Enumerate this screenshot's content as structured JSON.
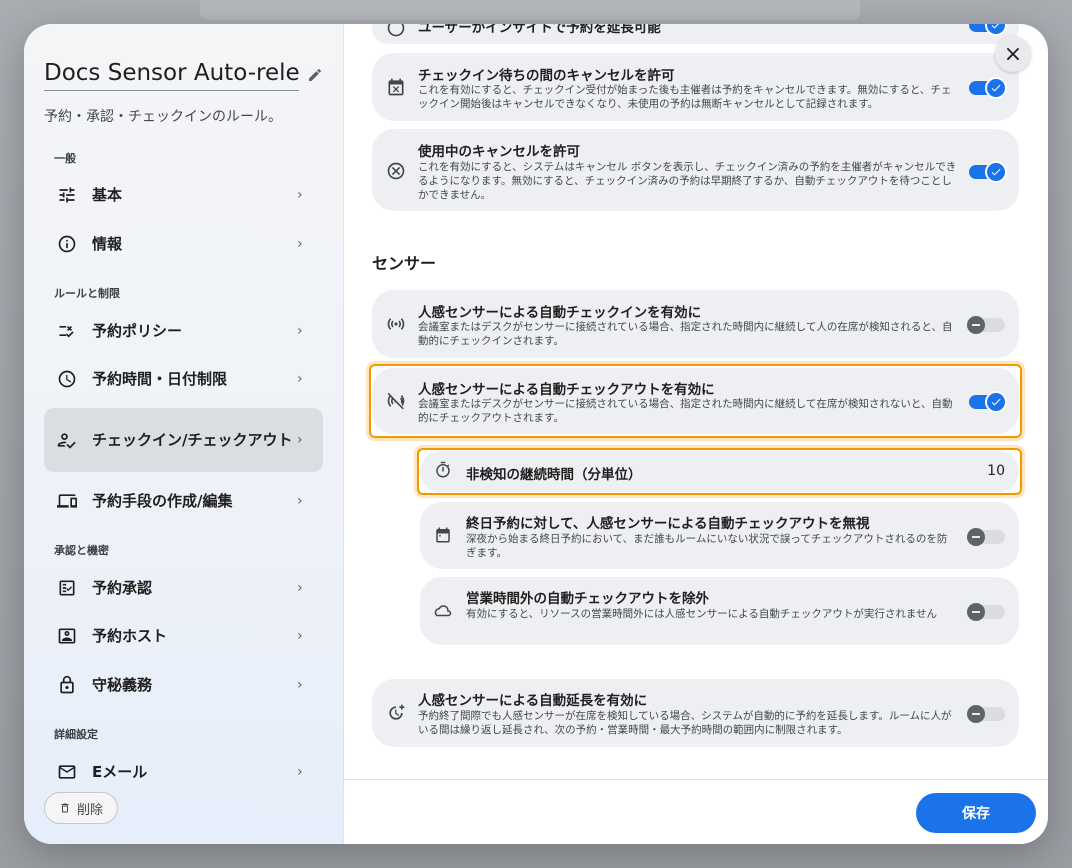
{
  "dialog": {
    "title": "Docs Sensor Auto-release",
    "subtitle": "予約・承認・チェックインのルール。",
    "close_label": "×",
    "delete_label": "削除",
    "save_label": "保存"
  },
  "sidebar": {
    "sections": [
      {
        "label": "一般"
      },
      {
        "label": "ルールと制限"
      },
      {
        "label": "承認と機密"
      },
      {
        "label": "詳細設定"
      }
    ],
    "items": [
      {
        "label": "基本",
        "icon": "tune-icon"
      },
      {
        "label": "情報",
        "icon": "info-icon"
      },
      {
        "label": "予約ポリシー",
        "icon": "rule-icon"
      },
      {
        "label": "予約時間・日付制限",
        "icon": "clock-icon"
      },
      {
        "label": "チェックイン/チェックアウト",
        "icon": "person-check-icon",
        "active": true
      },
      {
        "label": "予約手段の作成/編集",
        "icon": "devices-icon"
      },
      {
        "label": "予約承認",
        "icon": "approval-icon"
      },
      {
        "label": "予約ホスト",
        "icon": "host-icon"
      },
      {
        "label": "守秘義務",
        "icon": "lock-icon"
      },
      {
        "label": "Eメール",
        "icon": "mail-icon"
      }
    ]
  },
  "main": {
    "cards_top": [
      {
        "title": "ユーザーがインサイトで予約を延長可能",
        "desc": "",
        "toggle": "on"
      },
      {
        "title": "チェックイン待ちの間のキャンセルを許可",
        "desc": "これを有効にすると、チェックイン受付が始まった後も主催者は予約をキャンセルできます。無効にすると、チェックイン開始後はキャンセルできなくなり、未使用の予約は無断キャンセルとして記録されます。",
        "toggle": "on"
      },
      {
        "title": "使用中のキャンセルを許可",
        "desc": "これを有効にすると、システムはキャンセル ボタンを表示し、チェックイン済みの予約を主催者がキャンセルできるようになります。無効にすると、チェックイン済みの予約は早期終了するか、自動チェックアウトを待つことしかできません。",
        "toggle": "on"
      }
    ],
    "sensor_section": "センサー",
    "sensor_checkin": {
      "title": "人感センサーによる自動チェックインを有効に",
      "desc": "会議室またはデスクがセンサーに接続されている場合、指定された時間内に継続して人の在席が検知されると、自動的にチェックインされます。",
      "toggle": "off"
    },
    "sensor_checkout": {
      "title": "人感センサーによる自動チェックアウトを有効に",
      "desc": "会議室またはデスクがセンサーに接続されている場合、指定された時間内に継続して在席が検知されないと、自動的にチェックアウトされます。",
      "toggle": "on"
    },
    "absence_duration": {
      "label": "非検知の継続時間（分単位）",
      "value": "10"
    },
    "ignore_allday": {
      "title": "終日予約に対して、人感センサーによる自動チェックアウトを無視",
      "desc": "深夜から始まる終日予約において、まだ誰もルームにいない状況で誤ってチェックアウトされるのを防ぎます。",
      "toggle": "off"
    },
    "exclude_offhours": {
      "title": "営業時間外の自動チェックアウトを除外",
      "desc": "有効にすると、リソースの営業時間外には人感センサーによる自動チェックアウトが実行されません",
      "toggle": "off"
    },
    "auto_extend": {
      "title": "人感センサーによる自動延長を有効に",
      "desc": "予約終了間際でも人感センサーが在席を検知している場合、システムが自動的に予約を延長します。ルームに人がいる間は繰り返し延長され、次の予約・営業時間・最大予約時間の範囲内に制限されます。",
      "toggle": "off"
    }
  }
}
